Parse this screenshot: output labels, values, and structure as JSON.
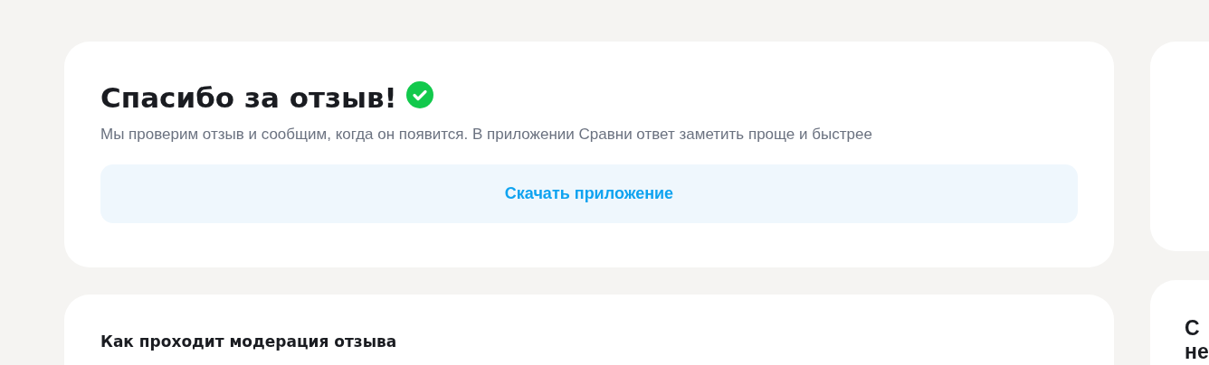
{
  "success_card": {
    "title": "Спасибо за отзыв!",
    "text": "Мы проверим отзыв и сообщим, когда он появится. В приложении Сравни ответ заметить проще и быстрее",
    "button": "Скачать приложение"
  },
  "moderation_card": {
    "title": "Как проходит модерация отзыва"
  },
  "side_card": {
    "title_lines": [
      "С",
      "не"
    ]
  }
}
